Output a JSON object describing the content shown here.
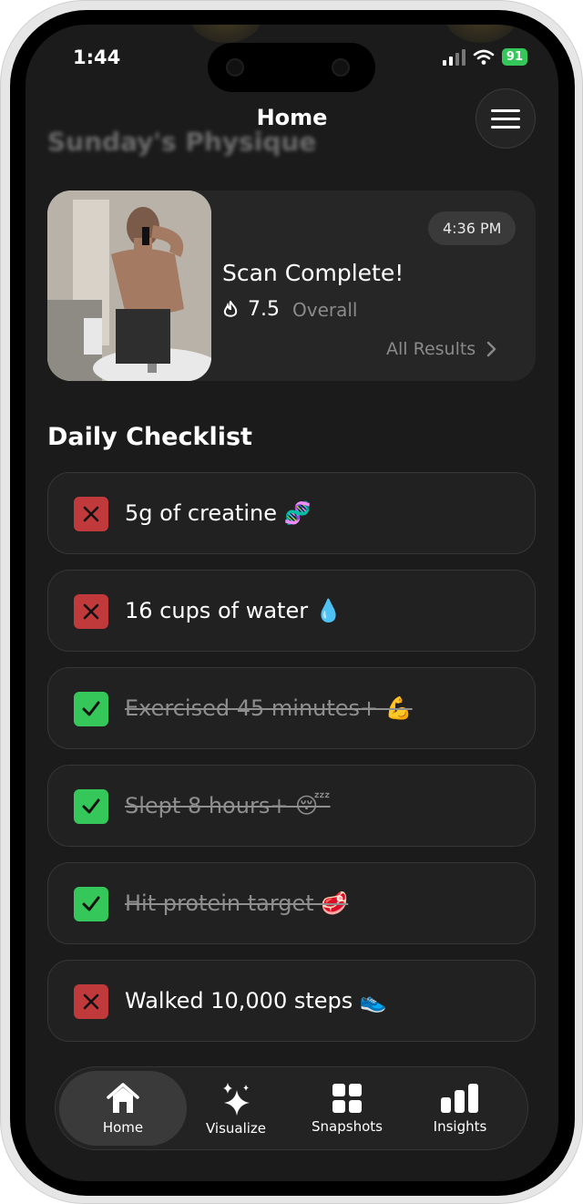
{
  "status": {
    "time": "1:44",
    "battery": "91"
  },
  "header": {
    "title": "Home",
    "blurred_title": "Sunday's Physique"
  },
  "scan": {
    "time": "4:36 PM",
    "title": "Scan Complete!",
    "score": "7.5",
    "score_label": "Overall",
    "results_link": "All Results"
  },
  "checklist": {
    "title": "Daily Checklist",
    "items": [
      {
        "label": "5g of creatine 🧬",
        "done": false
      },
      {
        "label": "16 cups of water 💧",
        "done": false
      },
      {
        "label": "Exercised 45 minutes+ 💪",
        "done": true
      },
      {
        "label": "Slept 8 hours+ 😴",
        "done": true
      },
      {
        "label": "Hit protein target 🥩",
        "done": true
      },
      {
        "label": "Walked 10,000 steps 👟",
        "done": false
      }
    ]
  },
  "tabs": [
    {
      "label": "Home",
      "icon": "home-icon",
      "active": true
    },
    {
      "label": "Visualize",
      "icon": "sparkles-icon",
      "active": false
    },
    {
      "label": "Snapshots",
      "icon": "grid-icon",
      "active": false
    },
    {
      "label": "Insights",
      "icon": "bar-chart-icon",
      "active": false
    }
  ]
}
